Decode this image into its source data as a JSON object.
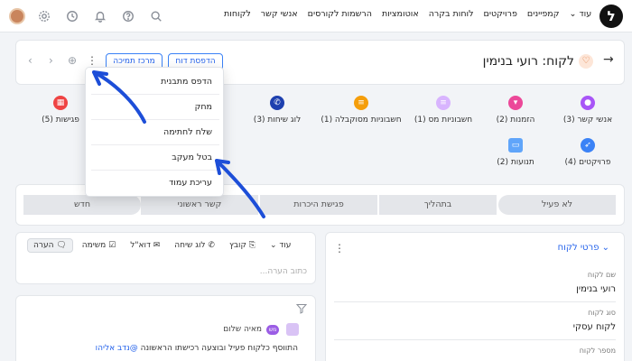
{
  "topbar": {
    "logo": "ל",
    "nav": [
      "לקוחות",
      "אנשי קשר",
      "הרשמות לקורסים",
      "אוטומציות",
      "לוחות בקרה",
      "פרויקטים",
      "קמפיינים",
      "עוד ⌄"
    ],
    "icons": [
      "settings-icon",
      "clock-icon",
      "bell-icon",
      "help-icon",
      "search-icon"
    ]
  },
  "header": {
    "title": "לקוח: רועי בנימין",
    "report_button": "הדפסת דוח",
    "support_button": "מרכז תמיכה"
  },
  "entities": {
    "row1": [
      {
        "label": "אנשי קשר (3)",
        "color": "#a855f7",
        "icon": "user-icon"
      },
      {
        "label": "הזמנות (2)",
        "color": "#ec4899",
        "icon": "cart-icon"
      },
      {
        "label": "חשבוניות מס (1)",
        "color": "#d8b4fe",
        "icon": "invoice-icon"
      },
      {
        "label": "חשבוניות מסוקבלה (1)",
        "color": "#f59e0b",
        "icon": "receipt-icon"
      },
      {
        "label": "לוג שיחות (3)",
        "color": "#1e40af",
        "icon": "phone-icon"
      },
      {
        "label": "פגישות (5)",
        "color": "#ef4444",
        "icon": "calendar-icon"
      }
    ],
    "row2": [
      {
        "label": "פרויקטים (4)",
        "color": "#3b82f6",
        "icon": "rocket-icon"
      },
      {
        "label": "תנועות (2)",
        "color": "#60a5fa",
        "icon": "card-icon"
      }
    ]
  },
  "pipeline": [
    "חדש",
    "קשר ראשוני",
    "פגישת היכרות",
    "בתהליך",
    "לא פעיל"
  ],
  "details": {
    "title": "פרטי לקוח",
    "fields": [
      {
        "label": "שם לקוח",
        "value": "רועי בנימין"
      },
      {
        "label": "סוג לקוח",
        "value": "לקוח עסקי"
      },
      {
        "label": "מספר לקוח",
        "value": ""
      }
    ]
  },
  "activity": {
    "tabs": [
      "הערה",
      "משימה",
      "דוא\"ל",
      "לוג שיחה",
      "קובץ",
      "עוד ⌄"
    ],
    "comment_placeholder": "כתוב הערה...",
    "feed_author": "מאיה שלום",
    "feed_badge": "מש",
    "feed_text": "התווסף כלקוח פעיל ובוצעה רכישתו הראשונה",
    "feed_mention": "@נדב אליהו"
  },
  "menu": {
    "items": [
      "הדפס מתבנית",
      "מחק",
      "שלח לחתימה",
      "בטל מעקב",
      "עריכת עמוד"
    ]
  },
  "colors": {
    "accent": "#2563eb",
    "arrow": "#1d4ed8"
  }
}
